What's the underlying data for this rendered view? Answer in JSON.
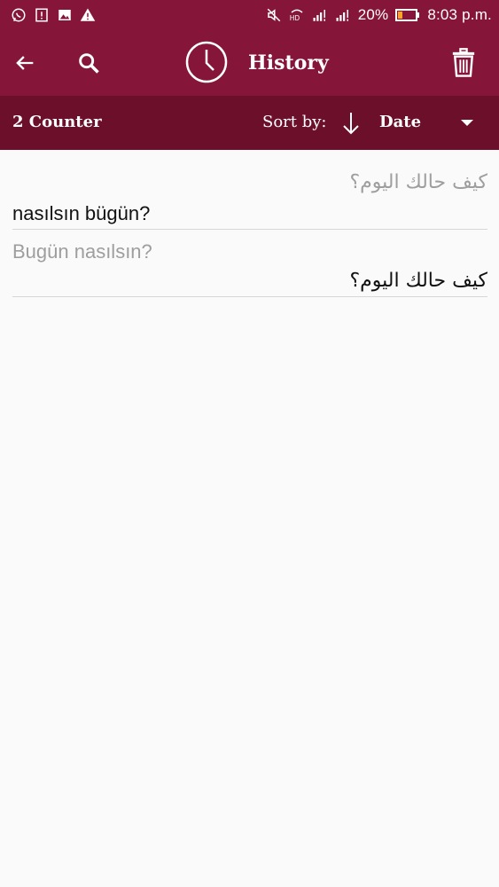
{
  "status_bar": {
    "left_icons": [
      "whatsapp-icon",
      "notification-alert-icon",
      "image-icon",
      "warning-icon"
    ],
    "right_icons": [
      "mute-icon",
      "hd-signal-icon",
      "signal-icon",
      "signal-icon-2",
      "battery-icon"
    ],
    "battery": "20%",
    "time": "8:03 p.m."
  },
  "appbar": {
    "title": "History",
    "icons": [
      "back-arrow-icon",
      "search-icon",
      "clock-icon",
      "trash-icon"
    ]
  },
  "subheader": {
    "counter": "2 Counter",
    "sort_label": "Sort by:",
    "sort_value": "Date"
  },
  "history": [
    {
      "source": "كيف حالك اليوم؟",
      "translation": "nasılsın bügün?"
    },
    {
      "source": "Bugün nasılsın?",
      "translation": "كيف حالك اليوم؟"
    }
  ],
  "colors": {
    "primary": "#85163a",
    "primary_dark": "#6b0f2b",
    "muted_text": "#9e9e9e"
  }
}
